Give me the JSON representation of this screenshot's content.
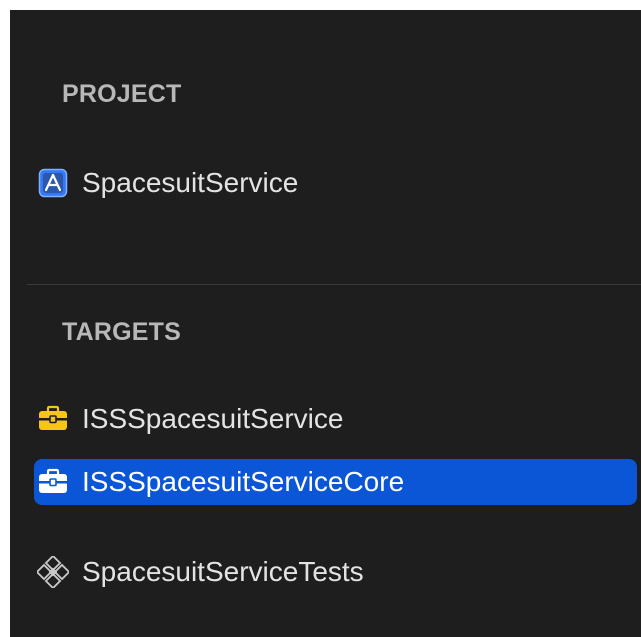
{
  "project_section": {
    "title": "PROJECT",
    "items": [
      {
        "label": "SpacesuitService",
        "icon": "app-store-icon"
      }
    ]
  },
  "targets_section": {
    "title": "TARGETS",
    "items": [
      {
        "label": "ISSSpacesuitService",
        "icon": "framework-toolbox-icon",
        "selected": false
      },
      {
        "label": "ISSSpacesuitServiceCore",
        "icon": "framework-toolbox-icon",
        "selected": true
      },
      {
        "label": "SpacesuitServiceTests",
        "icon": "test-bundle-icon",
        "selected": false
      }
    ]
  },
  "colors": {
    "background": "#1e1e1e",
    "selection": "#0a56d6",
    "section_title": "#b8b8b8",
    "item_text": "#e3e3e3",
    "toolbox_yellow": "#f5c518",
    "app_icon_blue": "#3478f6"
  }
}
